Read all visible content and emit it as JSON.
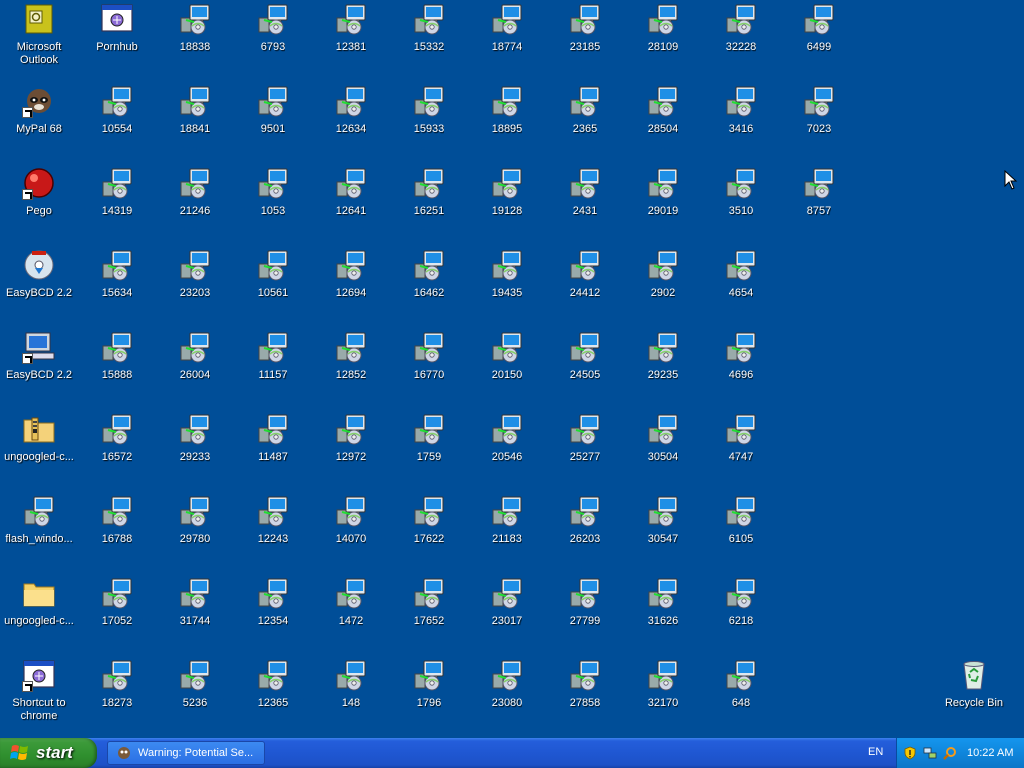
{
  "desktop": {
    "special_icons": [
      {
        "label": "Microsoft Outlook",
        "kind": "outlook"
      },
      {
        "label": "Pornhub",
        "kind": "window"
      },
      {
        "label": "MyPal 68",
        "kind": "raccoon",
        "shortcut": true
      },
      {
        "label": "Pego",
        "kind": "redball",
        "shortcut": true
      },
      {
        "label": "EasyBCD 2.2",
        "kind": "disc"
      },
      {
        "label": "EasyBCD 2.2",
        "kind": "computer",
        "shortcut": true
      },
      {
        "label": "ungoogled-c...",
        "kind": "zipfolder"
      },
      {
        "label": "flash_windo...",
        "kind": "installer"
      },
      {
        "label": "ungoogled-c...",
        "kind": "folder"
      },
      {
        "label": "Shortcut to chrome",
        "kind": "window",
        "shortcut": true
      },
      {
        "label": "Recycle Bin",
        "kind": "recyclebin"
      }
    ],
    "installer_columns": [
      [
        "18838",
        "18841",
        "21246",
        "23203",
        "26004",
        "29233",
        "29780",
        "31744",
        "5236"
      ],
      [
        "6793",
        "9501",
        "1053",
        "10561",
        "11157",
        "11487",
        "12243",
        "12354",
        "12365"
      ],
      [
        "12381",
        "12634",
        "12641",
        "12694",
        "12852",
        "12972",
        "14070",
        "1472",
        "148"
      ],
      [
        "15332",
        "15933",
        "16251",
        "16462",
        "16770",
        "1759",
        "17622",
        "17652",
        "1796"
      ],
      [
        "18774",
        "18895",
        "19128",
        "19435",
        "20150",
        "20546",
        "21183",
        "23017",
        "23080"
      ],
      [
        "23185",
        "2365",
        "2431",
        "24412",
        "24505",
        "25277",
        "26203",
        "27799",
        "27858"
      ],
      [
        "28109",
        "28504",
        "29019",
        "2902",
        "29235",
        "30504",
        "30547",
        "31626",
        "32170"
      ],
      [
        "32228",
        "3416",
        "3510",
        "4654",
        "4696",
        "4747",
        "6105",
        "6218",
        "648"
      ],
      [
        "6499",
        "7023",
        "8757"
      ]
    ],
    "installer_column0": [
      "10554",
      "14319",
      "15634",
      "15888",
      "16572",
      "16788",
      "17052",
      "18273"
    ]
  },
  "taskbar": {
    "start_label": "start",
    "task_item_label": "Warning: Potential Se...",
    "language": "EN",
    "clock": "10:22 AM",
    "tray_icons": [
      "shield-icon",
      "network-icon",
      "magnifier-icon"
    ]
  },
  "colors": {
    "desktop_bg": "#004e98",
    "taskbar_blue": "#245edb",
    "start_green": "#3c9a3a",
    "tray_blue": "#0f86dc"
  }
}
